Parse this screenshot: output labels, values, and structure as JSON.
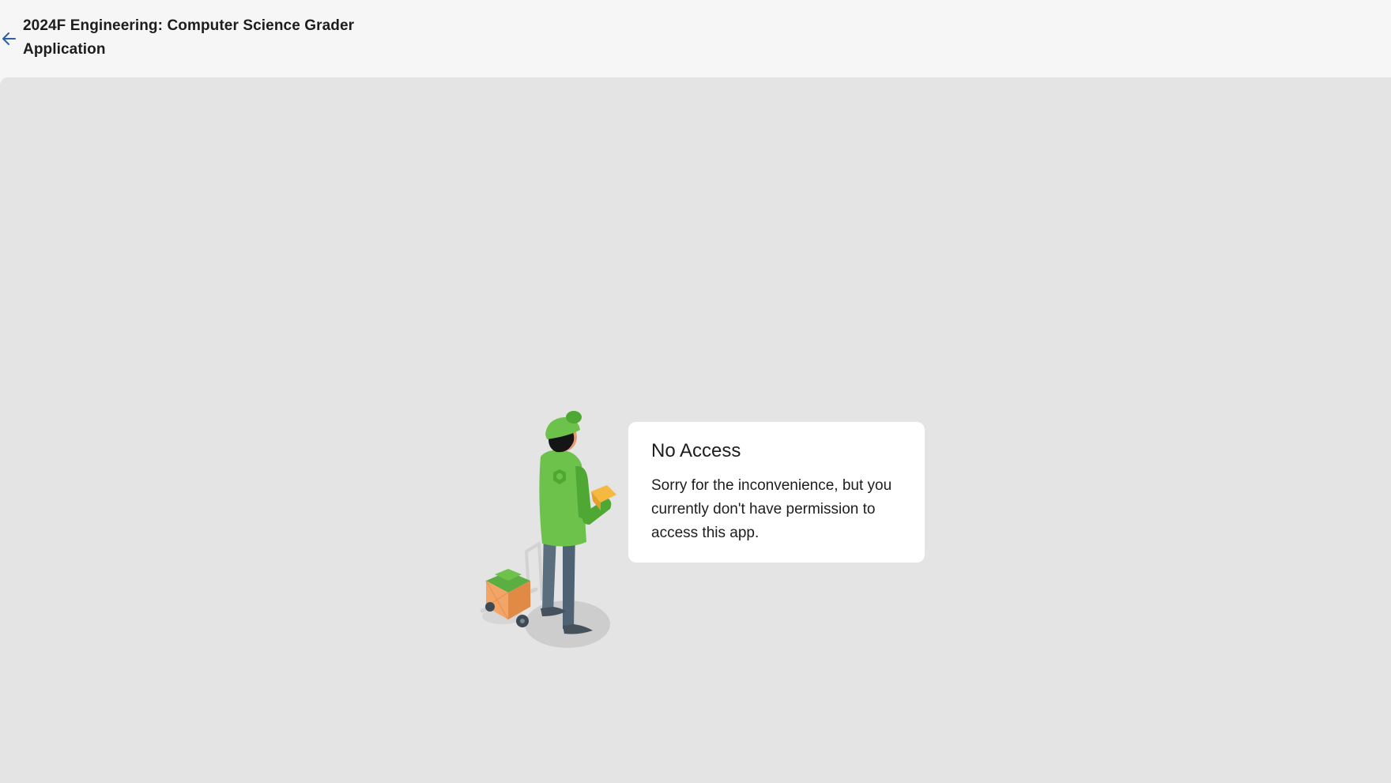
{
  "header": {
    "title": "2024F Engineering: Computer Science Grader Application",
    "back_icon": "arrow-left-icon"
  },
  "notice": {
    "title": "No Access",
    "message": "Sorry for the inconvenience, but you currently don't have permission to access this app."
  },
  "illustration": {
    "icon": "delivery-person-illustration"
  },
  "colors": {
    "header_bg": "#f6f6f6",
    "content_bg": "#e4e4e4",
    "card_bg": "#ffffff",
    "accent": "#2b5fa8",
    "figure_green": "#6cc24a"
  }
}
